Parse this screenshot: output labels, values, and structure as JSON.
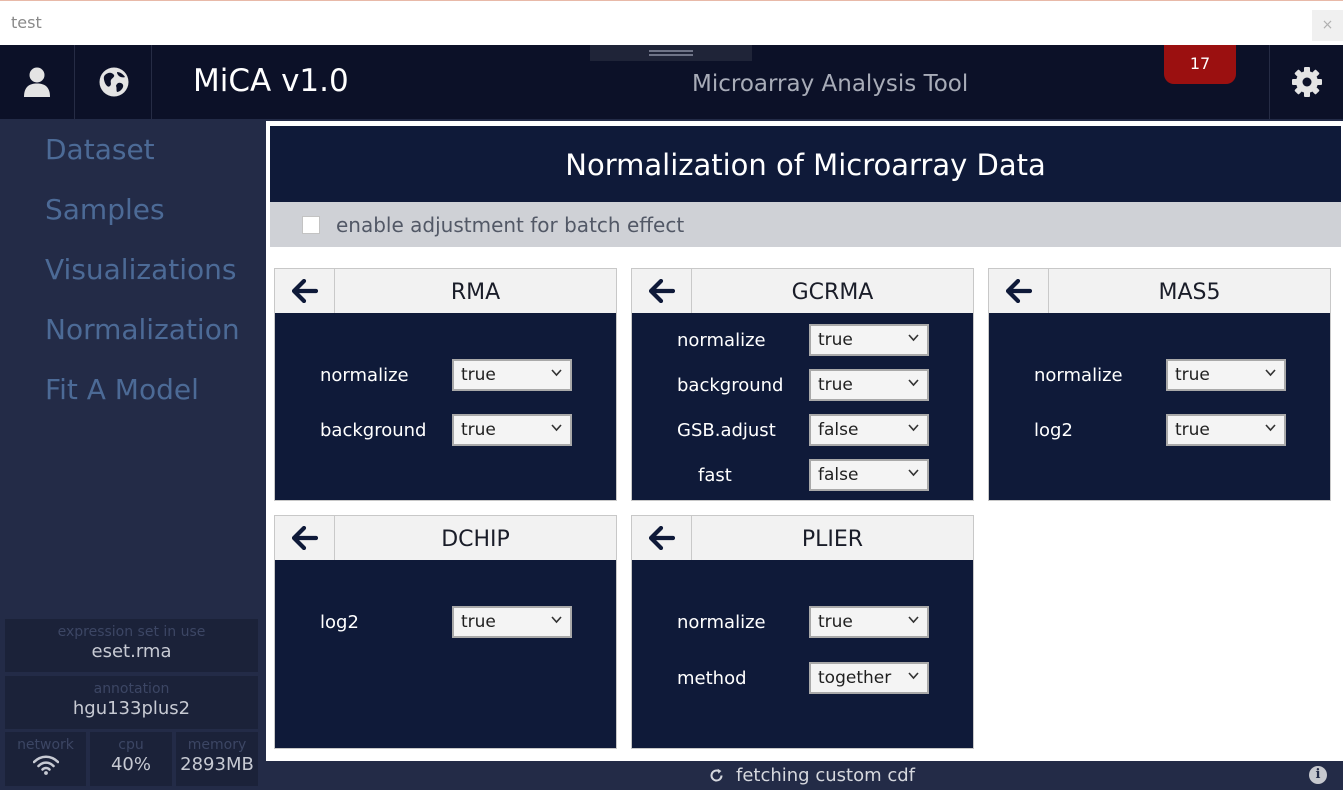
{
  "window": {
    "title": "test",
    "close_glyph": "×"
  },
  "header": {
    "app_name": "MiCA v1.0",
    "subtitle": "Microarray Analysis Tool",
    "notification_count": "17",
    "icons": [
      "user-icon",
      "globe-icon",
      "gear-icon"
    ]
  },
  "sidebar": {
    "nav": [
      "Dataset",
      "Samples",
      "Visualizations",
      "Normalization",
      "Fit A Model"
    ],
    "expression_set": {
      "label": "expression set in use",
      "value": "eset.rma"
    },
    "annotation": {
      "label": "annotation",
      "value": "hgu133plus2"
    },
    "stats": {
      "network": {
        "label": "network"
      },
      "cpu": {
        "label": "cpu",
        "value": "40%"
      },
      "memory": {
        "label": "memory",
        "value": "2893MB"
      }
    }
  },
  "main": {
    "title": "Normalization of Microarray Data",
    "batch_label": "enable adjustment for batch effect",
    "batch_checked": false,
    "panels": {
      "rma": {
        "title": "RMA",
        "fields": [
          {
            "label": "normalize",
            "value": "true"
          },
          {
            "label": "background",
            "value": "true"
          }
        ]
      },
      "gcrma": {
        "title": "GCRMA",
        "fields": [
          {
            "label": "normalize",
            "value": "true"
          },
          {
            "label": "background",
            "value": "true"
          },
          {
            "label": "GSB.adjust",
            "value": "false"
          },
          {
            "label": "fast",
            "value": "false"
          }
        ]
      },
      "mas5": {
        "title": "MAS5",
        "fields": [
          {
            "label": "normalize",
            "value": "true"
          },
          {
            "label": "log2",
            "value": "true"
          }
        ]
      },
      "dchip": {
        "title": "DCHIP",
        "fields": [
          {
            "label": "log2",
            "value": "true"
          }
        ]
      },
      "plier": {
        "title": "PLIER",
        "fields": [
          {
            "label": "normalize",
            "value": "true"
          },
          {
            "label": "method",
            "value": "together"
          }
        ]
      }
    }
  },
  "status": {
    "text": "fetching custom cdf",
    "info_glyph": "i"
  },
  "colors": {
    "header_bg": "#0c1128",
    "sidebar_bg": "#232b47",
    "panel_bg": "#0f1a39",
    "nav_text": "#4c6a96",
    "badge": "#9b1010"
  }
}
